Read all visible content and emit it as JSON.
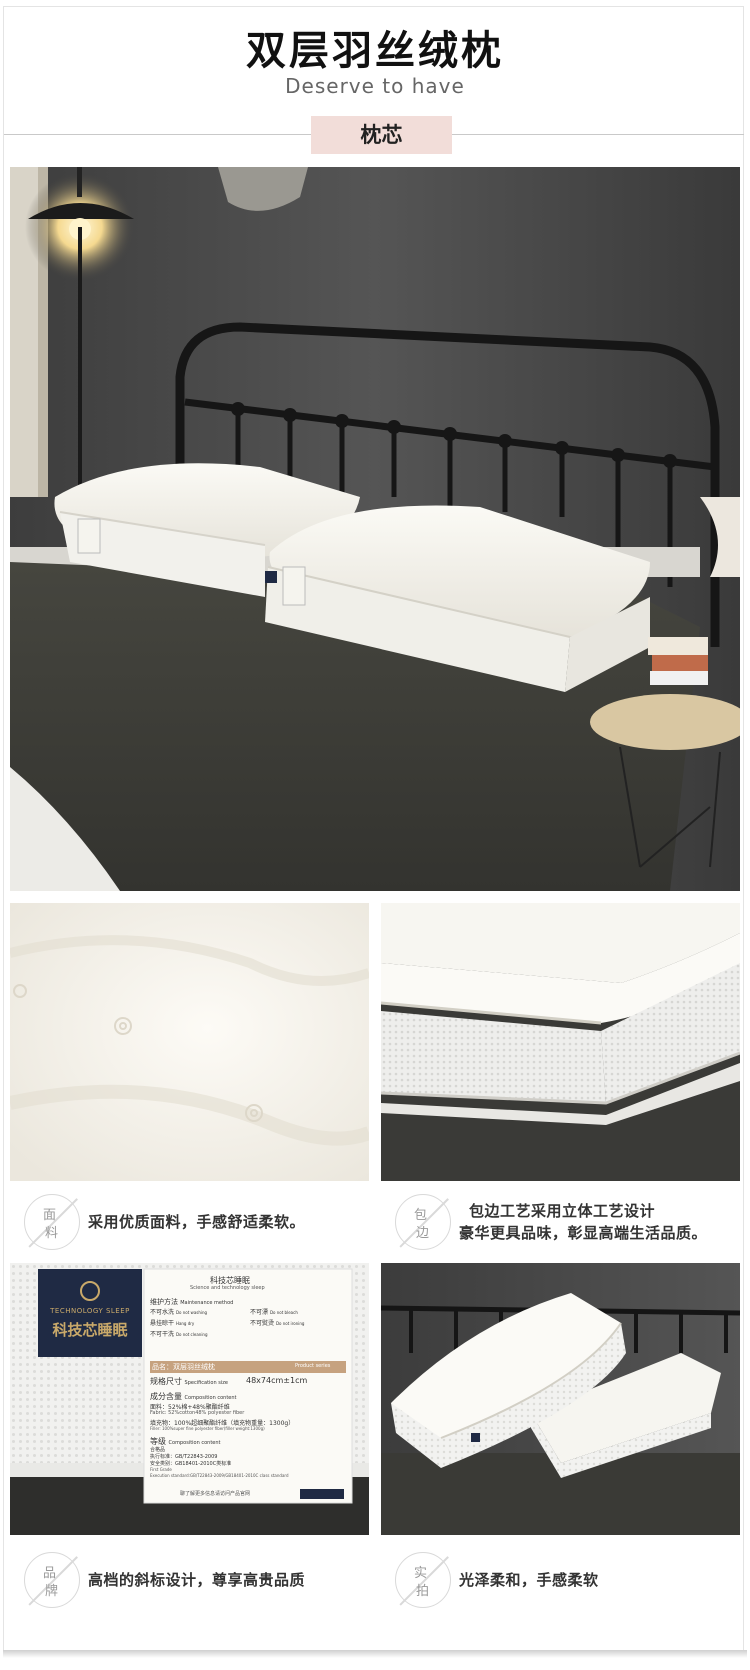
{
  "header": {
    "title": "双层羽丝绒枕",
    "subtitle": "Deserve to have",
    "section_tag": "枕芯"
  },
  "features": [
    {
      "badge_top": "面",
      "badge_bottom": "料",
      "text": "采用优质面料，手感舒适柔软。"
    },
    {
      "badge_top": "包",
      "badge_bottom": "边",
      "text_line1": "包边工艺采用立体工艺设计",
      "text_line2": "豪华更具品味，彰显高端生活品质。"
    },
    {
      "badge_top": "品",
      "badge_bottom": "牌",
      "text": "高档的斜标设计，尊享高贵品质"
    },
    {
      "badge_top": "实",
      "badge_bottom": "拍",
      "text": "光泽柔和，手感柔软"
    }
  ],
  "product_label": {
    "brand_en": "TECHNOLOGY SLEEP",
    "brand_cn": "科技芯睡眠",
    "tag_header": "科技芯睡眠",
    "tag_header_en": "Science and technology sleep",
    "maintenance": "维护方法",
    "maintenance_en": "Maintenance method",
    "care": [
      "不可水洗",
      "不可漂",
      "悬挂晾干",
      "不可熨烫",
      "不可干洗"
    ],
    "care_en": [
      "Do not washing",
      "Do not bleach",
      "Hang dry",
      "Do not ironing",
      "Do not cleaning"
    ],
    "product_name": "品名：双层羽丝绒枕",
    "product_series": "Product series",
    "size_label": "规格尺寸",
    "size_label_en": "Specification size",
    "size_value": "48x74cm±1cm",
    "composition": "成分含量",
    "composition_en": "Composition content",
    "fabric": "面料：52%棉+48%聚酯纤维",
    "fabric_en": "Fabric: 52%cotton48% polyester fiber",
    "filler": "填充物：100%超细聚酯纤维（填充物重量：1300g）",
    "filler_en": "Filler: 100%super fine polyester fiber(filler weight:1300g)",
    "grade": "等级",
    "grade_en": "Composition content",
    "grade_value": "合格品",
    "standard": "执行标准：GB/T22843-2009",
    "standard2": "安全类别：GB18401-2010C类标准",
    "grade_en2": "First Grade",
    "standard_en": "Execution standard:GB/T22843-2009/GB18401-2010C class standard",
    "footer": "聊了解更多信息请访问产品官网"
  },
  "colors": {
    "accent_tag": "#f2ddd9",
    "wall": "#4a4a4a",
    "blanket": "#3b3b37",
    "pillow": "#f7f5ef",
    "label_navy": "#1f2a44",
    "label_gold": "#c9a96a"
  }
}
